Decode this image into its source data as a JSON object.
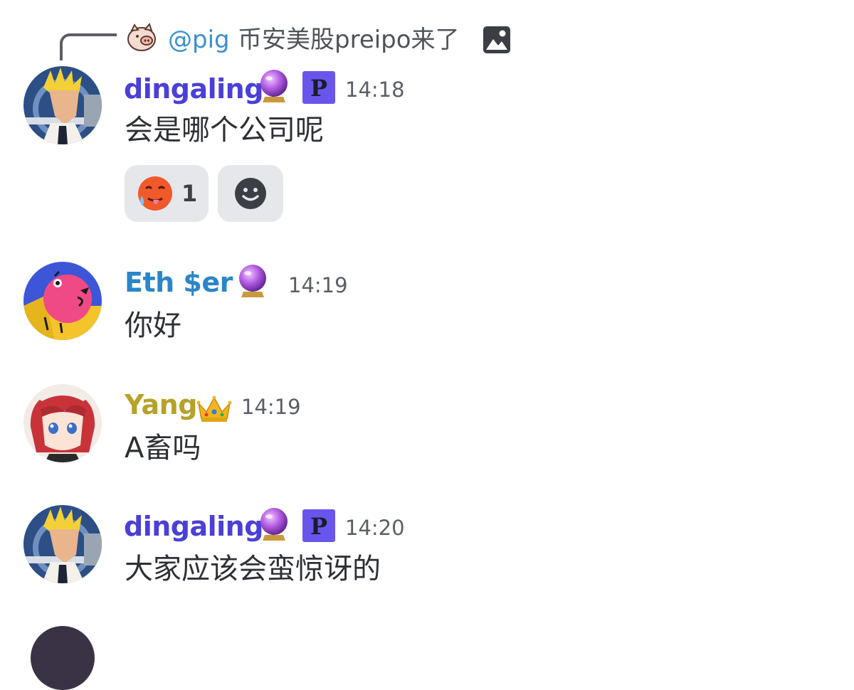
{
  "reply": {
    "mention": "@pig",
    "text": "币安美股preipo来了"
  },
  "messages": [
    {
      "author": "dingaling",
      "time": "14:18",
      "content": "会是哪个公司呢",
      "name_color": "#4b3fd8",
      "badges": [
        "crystal-ball-icon",
        "p-badge-icon"
      ],
      "reactions": [
        {
          "emoji": "hot-face-icon",
          "count": "1"
        },
        {
          "emoji": "add-reaction-icon",
          "count": ""
        }
      ]
    },
    {
      "author": "Eth $er",
      "time": "14:19",
      "content": "你好",
      "name_color": "#2a86c8",
      "badges": [
        "crystal-ball-icon"
      ]
    },
    {
      "author": "Yang",
      "time": "14:19",
      "content": "A畜吗",
      "name_color": "#b5a22a",
      "badges": [
        "crown-icon"
      ]
    },
    {
      "author": "dingaling",
      "time": "14:20",
      "content": "大家应该会蛮惊讶的",
      "name_color": "#4b3fd8",
      "badges": [
        "crystal-ball-icon",
        "p-badge-icon"
      ]
    }
  ],
  "colors": {
    "mention": "#3a8fd0",
    "reaction_bg": "#e6e7ea",
    "timestamp": "#5c5e66"
  }
}
